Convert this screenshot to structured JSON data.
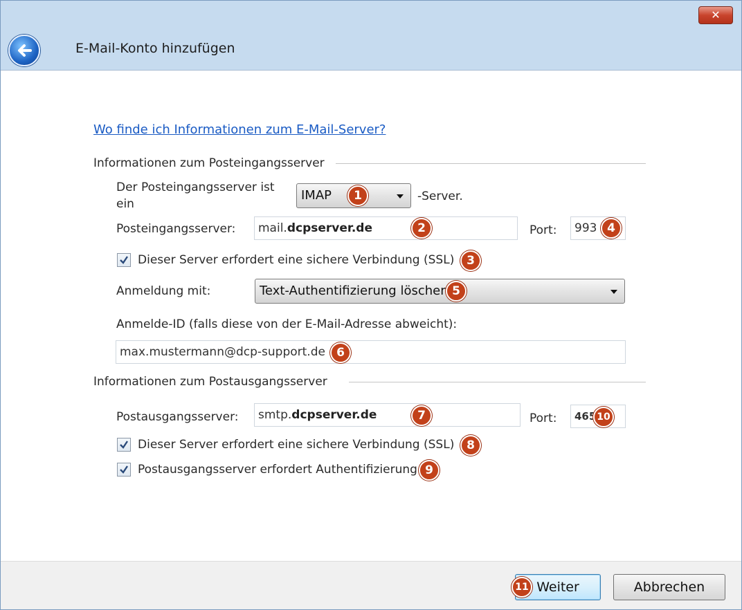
{
  "window": {
    "title": "E-Mail-Konto hinzufügen",
    "close_label": "✕"
  },
  "help_link": "Wo finde ich Informationen zum E-Mail-Server?",
  "incoming": {
    "group_label": "Informationen zum Posteingangsserver",
    "server_type_label_line1": "Der Posteingangsserver ist",
    "server_type_label_line2": "ein",
    "server_type_value": "IMAP",
    "server_type_suffix": "-Server.",
    "server_label": "Posteingangsserver:",
    "server_value_prefix": "mail.",
    "server_value_domain": "dcpserver.de",
    "port_label": "Port:",
    "port_value": "993",
    "ssl_label": "Dieser Server erfordert eine sichere Verbindung (SSL)",
    "ssl_checked": true,
    "login_label": "Anmeldung mit:",
    "login_value": "Text-Authentifizierung löschen",
    "login_id_label": "Anmelde-ID (falls diese von der E-Mail-Adresse abweicht):",
    "login_id_value": "max.mustermann@dcp-support.de"
  },
  "outgoing": {
    "group_label": "Informationen zum Postausgangsserver",
    "server_label": "Postausgangsserver:",
    "server_value_prefix": "smtp.",
    "server_value_domain": "dcpserver.de",
    "port_label": "Port:",
    "port_value": "465",
    "ssl_label": "Dieser Server erfordert eine sichere Verbindung (SSL)",
    "ssl_checked": true,
    "auth_label": "Postausgangsserver erfordert Authentifizierung",
    "auth_checked": true
  },
  "badges": [
    "1",
    "2",
    "3",
    "4",
    "5",
    "6",
    "7",
    "8",
    "9",
    "10",
    "11"
  ],
  "buttons": {
    "next": "Weiter",
    "cancel": "Abbrechen"
  },
  "colors": {
    "badge": "#c2411a",
    "link": "#1a5bc4",
    "titlebar": "#c6dbef"
  }
}
